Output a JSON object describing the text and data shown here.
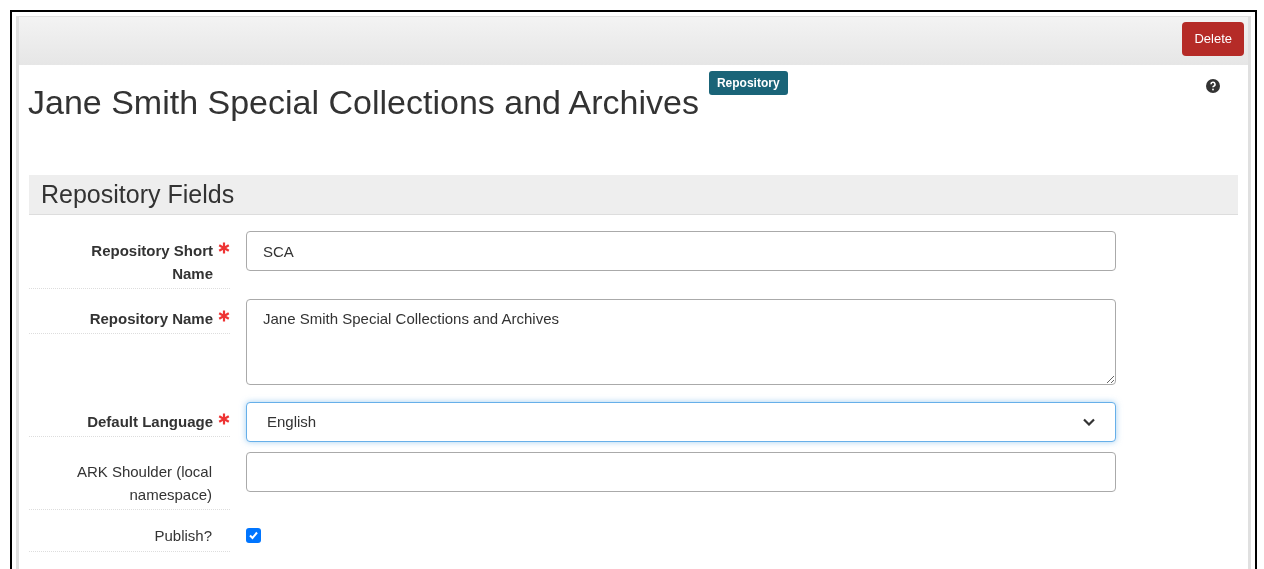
{
  "toolbar": {
    "delete_button": "Delete"
  },
  "title": "Jane Smith Special Collections and Archives",
  "badge": "Repository",
  "section": {
    "title": "Repository Fields"
  },
  "fields": [
    {
      "kind": "text",
      "label": "Repository Short Name",
      "required": true,
      "value": "SCA"
    },
    {
      "kind": "textarea",
      "label": "Repository Name",
      "required": true,
      "value": "Jane Smith Special Collections and Archives"
    },
    {
      "kind": "select",
      "label": "Default Language",
      "required": true,
      "value": "English",
      "focused": true
    },
    {
      "kind": "text",
      "label": "ARK Shoulder (local namespace)",
      "required": false
    },
    {
      "kind": "checkbox",
      "label": "Publish?",
      "required": false,
      "checked": true
    }
  ]
}
